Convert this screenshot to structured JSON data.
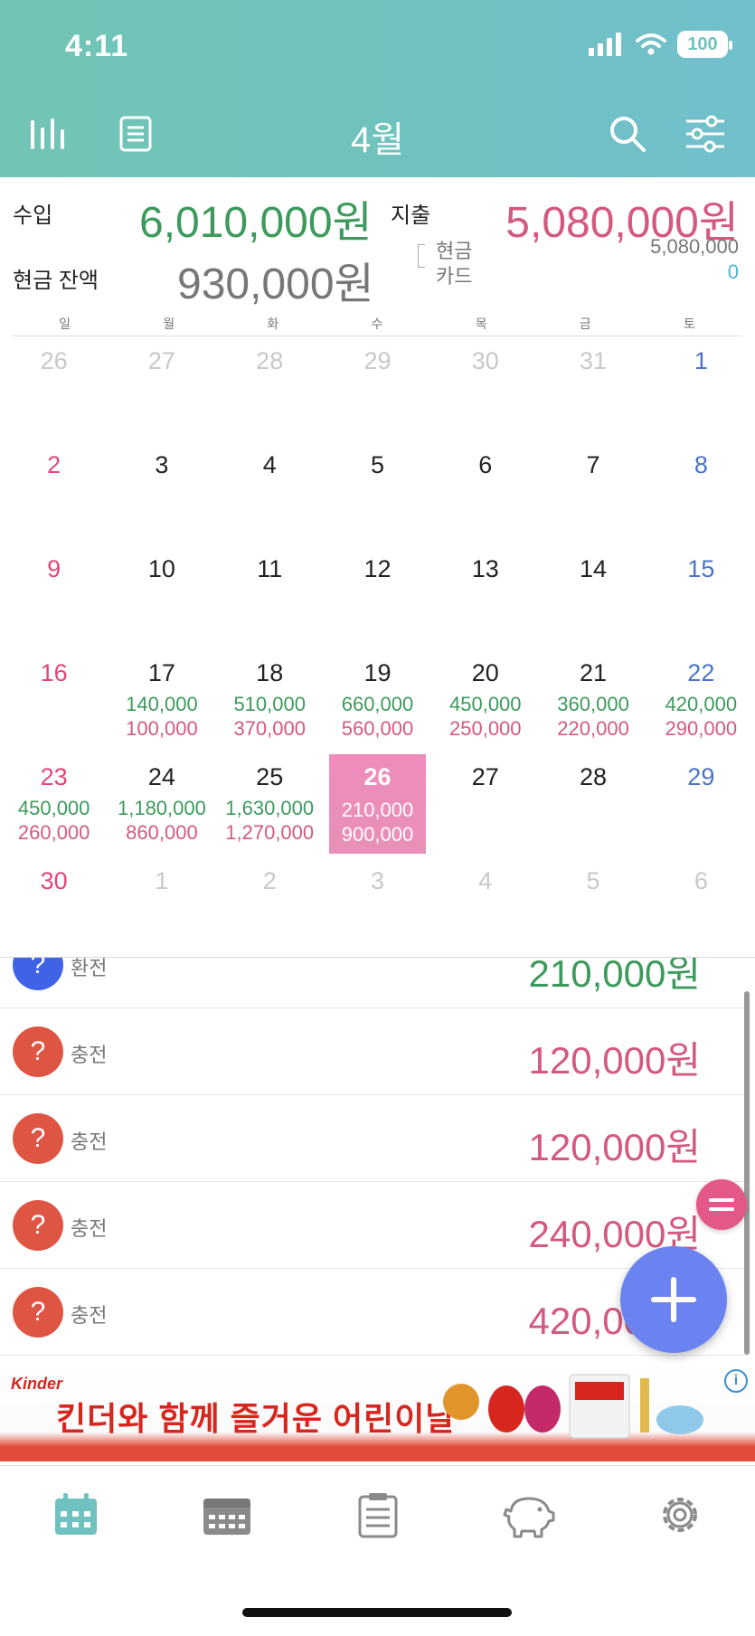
{
  "status": {
    "time": "4:11",
    "battery": "100"
  },
  "header": {
    "month": "4월"
  },
  "summary": {
    "income_label": "수입",
    "income_value": "6,010,000원",
    "expense_label": "지출",
    "expense_value": "5,080,000원",
    "cash_balance_label": "현금 잔액",
    "cash_balance_value": "930,000원",
    "cash_label": "현금",
    "cash_value": "5,080,000",
    "card_label": "카드",
    "card_value": "0"
  },
  "weekdays": [
    "일",
    "월",
    "화",
    "수",
    "목",
    "금",
    "토"
  ],
  "calendar": {
    "weeks": [
      [
        {
          "n": "26",
          "d": true
        },
        {
          "n": "27",
          "d": true
        },
        {
          "n": "28",
          "d": true
        },
        {
          "n": "29",
          "d": true
        },
        {
          "n": "30",
          "d": true
        },
        {
          "n": "31",
          "d": true
        },
        {
          "n": "1"
        }
      ],
      [
        {
          "n": "2"
        },
        {
          "n": "3"
        },
        {
          "n": "4"
        },
        {
          "n": "5"
        },
        {
          "n": "6"
        },
        {
          "n": "7"
        },
        {
          "n": "8"
        }
      ],
      [
        {
          "n": "9"
        },
        {
          "n": "10"
        },
        {
          "n": "11"
        },
        {
          "n": "12"
        },
        {
          "n": "13"
        },
        {
          "n": "14"
        },
        {
          "n": "15"
        }
      ],
      [
        {
          "n": "16"
        },
        {
          "n": "17",
          "i": "140,000",
          "e": "100,000"
        },
        {
          "n": "18",
          "i": "510,000",
          "e": "370,000"
        },
        {
          "n": "19",
          "i": "660,000",
          "e": "560,000"
        },
        {
          "n": "20",
          "i": "450,000",
          "e": "250,000"
        },
        {
          "n": "21",
          "i": "360,000",
          "e": "220,000"
        },
        {
          "n": "22",
          "i": "420,000",
          "e": "290,000"
        }
      ],
      [
        {
          "n": "23",
          "i": "450,000",
          "e": "260,000"
        },
        {
          "n": "24",
          "i": "1,180,000",
          "e": "860,000"
        },
        {
          "n": "25",
          "i": "1,630,000",
          "e": "1,270,000"
        },
        {
          "n": "26",
          "i": "210,000",
          "e": "900,000",
          "t": true
        },
        {
          "n": "27"
        },
        {
          "n": "28"
        },
        {
          "n": "29"
        }
      ],
      [
        {
          "n": "30"
        },
        {
          "n": "1",
          "d": true
        },
        {
          "n": "2",
          "d": true
        },
        {
          "n": "3",
          "d": true
        },
        {
          "n": "4",
          "d": true
        },
        {
          "n": "5",
          "d": true
        },
        {
          "n": "6",
          "d": true
        }
      ]
    ]
  },
  "transactions": [
    {
      "icon": "?",
      "name": "환전",
      "amount": "210,000원",
      "type": "income"
    },
    {
      "icon": "?",
      "name": "충전",
      "amount": "120,000원",
      "type": "expense"
    },
    {
      "icon": "?",
      "name": "충전",
      "amount": "120,000원",
      "type": "expense"
    },
    {
      "icon": "?",
      "name": "충전",
      "amount": "240,000원",
      "type": "expense"
    },
    {
      "icon": "?",
      "name": "충전",
      "amount": "420,000원",
      "type": "expense"
    }
  ],
  "ad": {
    "brand": "Kinder",
    "text": "킨더와 함께 즐거운 어린이날",
    "info": "i"
  },
  "tabs": [
    "calendar-tab",
    "weekly-tab",
    "list-tab",
    "savings-tab",
    "settings-tab"
  ],
  "colors": {
    "header": "#6fc2bf",
    "income": "#3d9a5c",
    "expense": "#d4597e",
    "today": "#ee8cbc",
    "fab": "#6b83f0",
    "fab_small": "#e45889"
  }
}
